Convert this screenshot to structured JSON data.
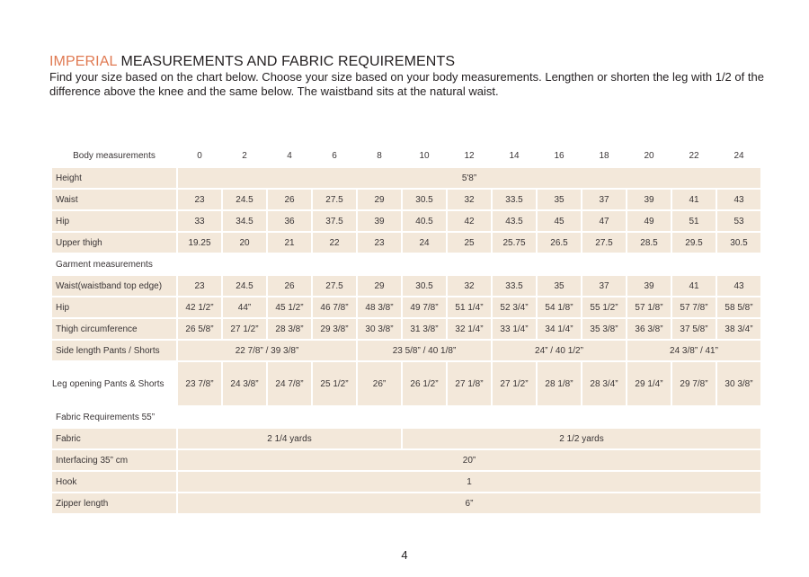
{
  "heading": {
    "accent": "IMPERIAL",
    "rest": " MEASUREMENTS AND FABRIC REQUIREMENTS"
  },
  "intro": "Find your size based on the chart below. Choose your size based on your body measurements. Lengthen or shorten the leg with 1/2 of the difference above the knee and the same below. The waistband sits at the natural waist.",
  "table": {
    "body_header": "Body measurements",
    "sizes": [
      "0",
      "2",
      "4",
      "6",
      "8",
      "10",
      "12",
      "14",
      "16",
      "18",
      "20",
      "22",
      "24"
    ],
    "height": {
      "label": "Height",
      "value": "5'8”"
    },
    "waist": {
      "label": "Waist",
      "values": [
        "23",
        "24.5",
        "26",
        "27.5",
        "29",
        "30.5",
        "32",
        "33.5",
        "35",
        "37",
        "39",
        "41",
        "43"
      ]
    },
    "hip": {
      "label": "Hip",
      "values": [
        "33",
        "34.5",
        "36",
        "37.5",
        "39",
        "40.5",
        "42",
        "43.5",
        "45",
        "47",
        "49",
        "51",
        "53"
      ]
    },
    "upper_thigh": {
      "label": "Upper thigh",
      "values": [
        "19.25",
        "20",
        "21",
        "22",
        "23",
        "24",
        "25",
        "25.75",
        "26.5",
        "27.5",
        "28.5",
        "29.5",
        "30.5"
      ]
    },
    "garment_header": "Garment measurements",
    "waistband": {
      "label": "Waist(waistband top edge)",
      "values": [
        "23",
        "24.5",
        "26",
        "27.5",
        "29",
        "30.5",
        "32",
        "33.5",
        "35",
        "37",
        "39",
        "41",
        "43"
      ]
    },
    "g_hip": {
      "label": "Hip",
      "values": [
        "42 1/2”",
        "44”",
        "45 1/2”",
        "46 7/8”",
        "48 3/8”",
        "49 7/8”",
        "51 1/4”",
        "52 3/4”",
        "54 1/8”",
        "55 1/2”",
        "57 1/8”",
        "57 7/8”",
        "58 5/8”"
      ]
    },
    "thigh_circ": {
      "label": "Thigh circumference",
      "values": [
        "26 5/8”",
        "27 1/2”",
        "28 3/8”",
        "29 3/8”",
        "30 3/8”",
        "31 3/8”",
        "32 1/4”",
        "33 1/4”",
        "34 1/4”",
        "35 3/8”",
        "36 3/8”",
        "37 5/8”",
        "38 3/4”"
      ]
    },
    "side_length": {
      "label": "Side length Pants / Shorts",
      "values": [
        "22 7/8” / 39 3/8”",
        "23 5/8” / 40 1/8”",
        "24” / 40 1/2”",
        "24 3/8” / 41”"
      ]
    },
    "leg_opening": {
      "label": "Leg opening Pants  & Shorts",
      "values": [
        "23 7/8”",
        "24 3/8”",
        "24 7/8”",
        "25 1/2”",
        "26”",
        "26 1/2”",
        "27 1/8”",
        "27 1/2”",
        "28 1/8”",
        "28 3/4”",
        "29 1/4”",
        "29 7/8”",
        "30 3/8”"
      ]
    },
    "fabric_header": "Fabric Requirements 55”",
    "fabric": {
      "label": "Fabric",
      "values": [
        "2 1/4 yards",
        "2 1/2 yards"
      ]
    },
    "interfacing": {
      "label": "Interfacing 35” cm",
      "value": "20”"
    },
    "hook": {
      "label": "Hook",
      "value": "1"
    },
    "zipper": {
      "label": "Zipper length",
      "value": "6”"
    }
  },
  "page_number": "4",
  "colors": {
    "accent": "#e07a52",
    "cell_bg": "#f3e8da",
    "text": "#231f20"
  }
}
